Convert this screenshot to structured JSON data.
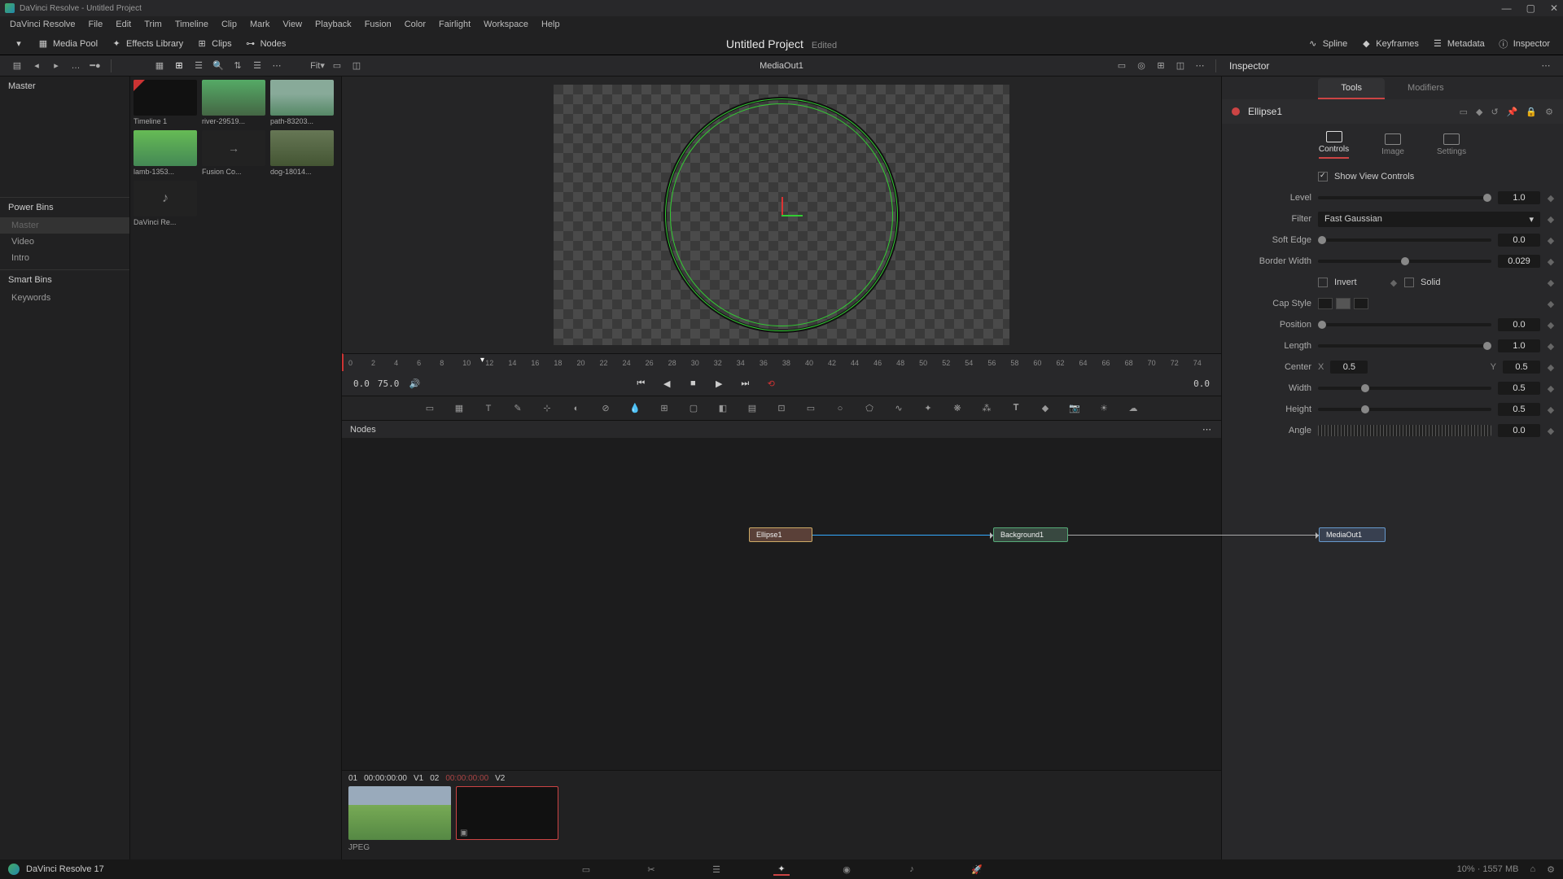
{
  "window": {
    "title": "DaVinci Resolve - Untitled Project"
  },
  "menu": [
    "DaVinci Resolve",
    "File",
    "Edit",
    "Trim",
    "Timeline",
    "Clip",
    "Mark",
    "View",
    "Playback",
    "Fusion",
    "Color",
    "Fairlight",
    "Workspace",
    "Help"
  ],
  "toolbar": {
    "media_pool": "Media Pool",
    "effects_library": "Effects Library",
    "clips": "Clips",
    "nodes": "Nodes",
    "spline": "Spline",
    "keyframes": "Keyframes",
    "metadata": "Metadata",
    "inspector": "Inspector"
  },
  "project": {
    "title": "Untitled Project",
    "status": "Edited"
  },
  "subbar": {
    "fit": "Fit▾",
    "viewer_title": "MediaOut1"
  },
  "bins": {
    "master": "Master",
    "power_bins": "Power Bins",
    "power_items": [
      "Master",
      "Video",
      "Intro"
    ],
    "smart_bins": "Smart Bins",
    "smart_items": [
      "Keywords"
    ]
  },
  "media": [
    {
      "label": "Timeline 1",
      "cls": "tl"
    },
    {
      "label": "river-29519...",
      "cls": "river"
    },
    {
      "label": "path-83203...",
      "cls": "path"
    },
    {
      "label": "lamb-1353...",
      "cls": "lamb"
    },
    {
      "label": "Fusion Co...",
      "cls": "fusion"
    },
    {
      "label": "dog-18014...",
      "cls": "dog"
    },
    {
      "label": "DaVinci Re...",
      "cls": "audio"
    }
  ],
  "ruler_ticks": [
    "0",
    "2",
    "4",
    "6",
    "8",
    "10",
    "12",
    "14",
    "16",
    "18",
    "20",
    "22",
    "24",
    "26",
    "28",
    "30",
    "32",
    "34",
    "36",
    "38",
    "40",
    "42",
    "44",
    "46",
    "48",
    "50",
    "52",
    "54",
    "56",
    "58",
    "60",
    "62",
    "64",
    "66",
    "68",
    "70",
    "72",
    "74"
  ],
  "transport": {
    "in": "0.0",
    "dur": "75.0",
    "out": "0.0"
  },
  "nodes": {
    "header": "Nodes",
    "ellipse": "Ellipse1",
    "background": "Background1",
    "mediaout": "MediaOut1"
  },
  "cliptray": {
    "c1_idx": "01",
    "c1_tc": "00:00:00:00",
    "c1_trk": "V1",
    "c2_idx": "02",
    "c2_tc": "00:00:00:00",
    "c2_trk": "V2",
    "format": "JPEG"
  },
  "inspector": {
    "title": "Inspector",
    "tabs": {
      "tools": "Tools",
      "modifiers": "Modifiers"
    },
    "node_name": "Ellipse1",
    "prop_tabs": {
      "controls": "Controls",
      "image": "Image",
      "settings": "Settings"
    },
    "show_view": "Show View Controls",
    "props": {
      "level": {
        "label": "Level",
        "val": "1.0"
      },
      "filter": {
        "label": "Filter",
        "val": "Fast Gaussian"
      },
      "soft_edge": {
        "label": "Soft Edge",
        "val": "0.0"
      },
      "border_width": {
        "label": "Border Width",
        "val": "0.029"
      },
      "invert": "Invert",
      "solid": "Solid",
      "cap_style": "Cap Style",
      "position": {
        "label": "Position",
        "val": "0.0"
      },
      "length": {
        "label": "Length",
        "val": "1.0"
      },
      "center": {
        "label": "Center",
        "x": "X",
        "xval": "0.5",
        "y": "Y",
        "yval": "0.5"
      },
      "width": {
        "label": "Width",
        "val": "0.5"
      },
      "height": {
        "label": "Height",
        "val": "0.5"
      },
      "angle": {
        "label": "Angle",
        "val": "0.0"
      }
    }
  },
  "status": {
    "app": "DaVinci Resolve 17",
    "mem": "10% · 1557 MB"
  }
}
